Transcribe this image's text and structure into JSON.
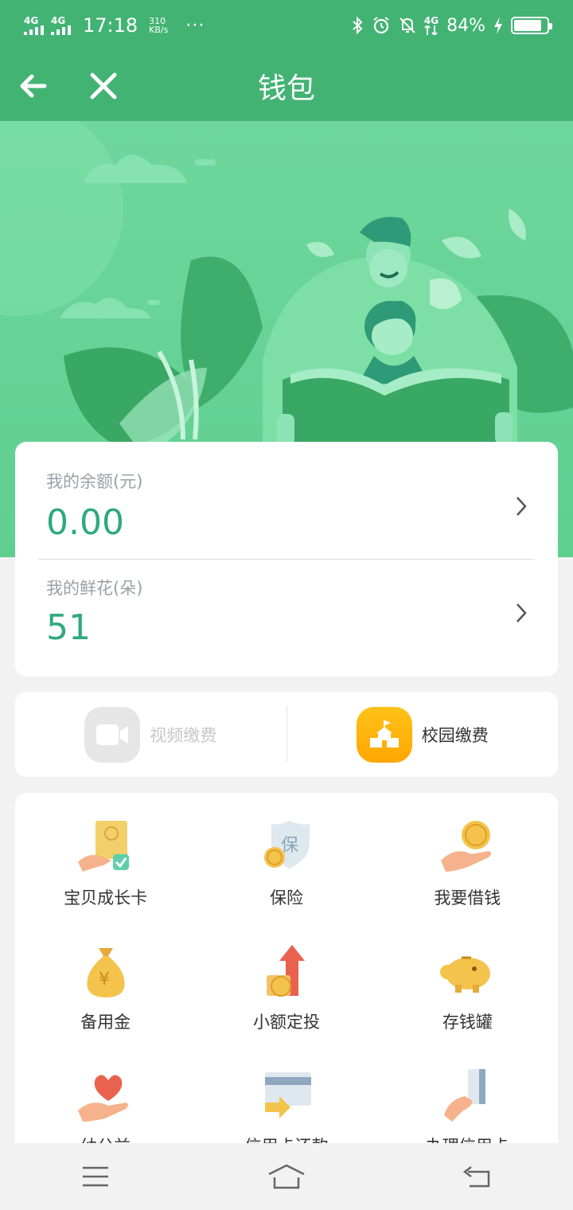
{
  "status_bar": {
    "network1": "4G",
    "network2": "4G",
    "time": "17:18",
    "speed_value": "310",
    "speed_unit": "KB/s",
    "more": "···",
    "network_right": "4G",
    "battery": "84%",
    "battery_level": 0.84
  },
  "nav": {
    "title": "钱包",
    "back_icon": "arrow-left-icon",
    "close_icon": "close-icon"
  },
  "balance": {
    "label": "我的余额(元)",
    "value": "0.00"
  },
  "flowers": {
    "label": "我的鲜花(朵)",
    "value": "51"
  },
  "payments": [
    {
      "label": "视频缴费",
      "icon": "video-camera-icon",
      "enabled": false
    },
    {
      "label": "校园缴费",
      "icon": "school-icon",
      "enabled": true
    }
  ],
  "services": [
    {
      "label": "宝贝成长卡",
      "icon": "growth-card-icon"
    },
    {
      "label": "保险",
      "icon": "insurance-shield-icon"
    },
    {
      "label": "我要借钱",
      "icon": "borrow-money-icon"
    },
    {
      "label": "备用金",
      "icon": "money-bag-icon"
    },
    {
      "label": "小额定投",
      "icon": "investment-arrow-icon"
    },
    {
      "label": "存钱罐",
      "icon": "piggy-bank-icon"
    },
    {
      "label": "幼公益",
      "icon": "charity-heart-icon"
    },
    {
      "label": "信用卡还款",
      "icon": "credit-card-repay-icon"
    },
    {
      "label": "办理信用卡",
      "icon": "apply-credit-card-icon"
    }
  ],
  "colors": {
    "header_green": "#43b374",
    "hero_green": "#6fd79d",
    "value_teal": "#2fa97e",
    "school_orange": "#ffb300"
  }
}
